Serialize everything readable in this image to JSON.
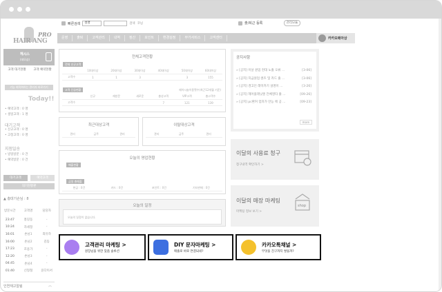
{
  "topbar": {
    "quick_search_label": "빠른검색",
    "quick_search_select": "성명",
    "search_btn": "검색",
    "hash_btn": "코닝",
    "commute_label": "출/퇴근 등록",
    "admin_btn": "관리모듈"
  },
  "logo": {
    "hair": "HAIR",
    "pro": "PRO",
    "ang": "ANG"
  },
  "nav": {
    "items": [
      "운영",
      "출퇴",
      "고객관리",
      "내역",
      "정산",
      "포인트",
      "환경설정",
      "부가서비스",
      "고객센터"
    ],
    "kakao": "카카오메아상"
  },
  "sidebar": {
    "brand_title": "헤시스",
    "brand_sub": "(데모샵)",
    "icon1": "고객\n대기현황",
    "icon2": "고객\n예약현황",
    "bar1": "기능 최적화하는 관리자 바로가기",
    "today": "Today!!",
    "today_items": [
      "• 예약고객 : 0 명",
      "• 생일고객 : 1 명"
    ],
    "wait_head": "대기고객",
    "wait_items": [
      "• 신규고객 : 0 명",
      "• 고정고객 : 0 명"
    ],
    "sales_head": "지점일송",
    "sales_items": [
      "• 방일방문 : 0 건",
      "• 예약방문 : 0 건"
    ],
    "btn_wait": "대기고객",
    "btn_res": "예약고객",
    "bar2": "대기현황판",
    "user_line": "총대기손님 : 8",
    "visit_head": [
      "방문시간",
      "고객명",
      "담당자"
    ],
    "visit_rows": [
      [
        "23:47",
        "홍길동",
        "-"
      ],
      [
        "10:24",
        "차세정",
        "-"
      ],
      [
        "16:01",
        "손님1",
        "최유하"
      ],
      [
        "16:00",
        "손님2",
        "김동"
      ],
      [
        "17:23",
        "조용가",
        "-"
      ],
      [
        "12:20",
        "손님3",
        "-"
      ],
      [
        "04:45",
        "손님4",
        "-"
      ],
      [
        "01:40",
        "신형철",
        "윤다이서"
      ]
    ],
    "bottom": "인연재고알림"
  },
  "main": {
    "total_title": "전체고객현황",
    "chip_new": "전체 신규고객",
    "row1_head": [
      "",
      "10대이상",
      "20대이상",
      "30대이상",
      "40대이상",
      "50대이상",
      "60대이상"
    ],
    "row1_vals": [
      "고객수",
      "1",
      "1",
      "3",
      "",
      "3",
      "155"
    ],
    "chip_reg": "고객 단골현황",
    "reg_note": "헤어시술이용횟수(최근12개월 기준)",
    "row2_head": [
      "",
      "신규",
      "재방문",
      "새로운",
      "충성고객",
      "VIP고객",
      "충고객수"
    ],
    "row2_vals": [
      "고객수",
      "",
      "",
      "",
      "7",
      "121",
      "139"
    ],
    "contact_title": "최근대상고객",
    "contact_head": [
      "관리",
      "금주",
      "관리"
    ],
    "leave_title": "이탈대상고객",
    "leave_head": [
      "관리",
      "금주",
      "관리"
    ],
    "sales_title": "오늘의 영업현황",
    "chip_sales1": "매출현황",
    "chip_sales2": "금일 총매출",
    "sales_row": [
      "현금 : 0건",
      "카드 : 0건",
      "포인트 : 0건",
      "기타판매 : 0건"
    ],
    "schedule_title": "오늘의 일정",
    "schedule_empty": "오늘의 일정이 없습니다."
  },
  "right": {
    "notice_title": "공지사항",
    "notices": [
      [
        "» [공지] 이날 원업 현대 노출 오류 ...",
        "[3-06]"
      ],
      [
        "» [공지] 지금원업 렌츠 및 카드 출 ...",
        "[3-06]"
      ],
      [
        "» [공지] 경고인 래미카기 설명이 ...",
        "[3-26]"
      ],
      [
        "» [공지] 헤어플래닛렌 전체영타 출 ...",
        "[09-26]"
      ],
      [
        "» [공지] pc환커 업차가 만능 에 공 ...",
        "[09-23]"
      ]
    ],
    "more": "more",
    "bill_title": "이달의 사용료 청구",
    "bill_sub": "청구내역 확인하기 >",
    "mkt_title": "이달의 매장 마케팅",
    "mkt_sub": "마케팅 정보 보기 >"
  },
  "promos": [
    {
      "title": "고객관리 마케팅 >",
      "sub": "원장님을 위한 맞춤 솔루션",
      "color": "#a97ef0"
    },
    {
      "title": "DIY 문자마케팅 >",
      "sub": "매출로 바로 연결되네?",
      "color": "#3d6fe0"
    },
    {
      "title": "카카오톡채널 >",
      "sub": "무엇을 친구까지 쌓을까?",
      "color": "#f4c12d"
    }
  ],
  "colors": {
    "accent_promo_border": "#111111",
    "panel_gray": "#f0f0f0"
  }
}
